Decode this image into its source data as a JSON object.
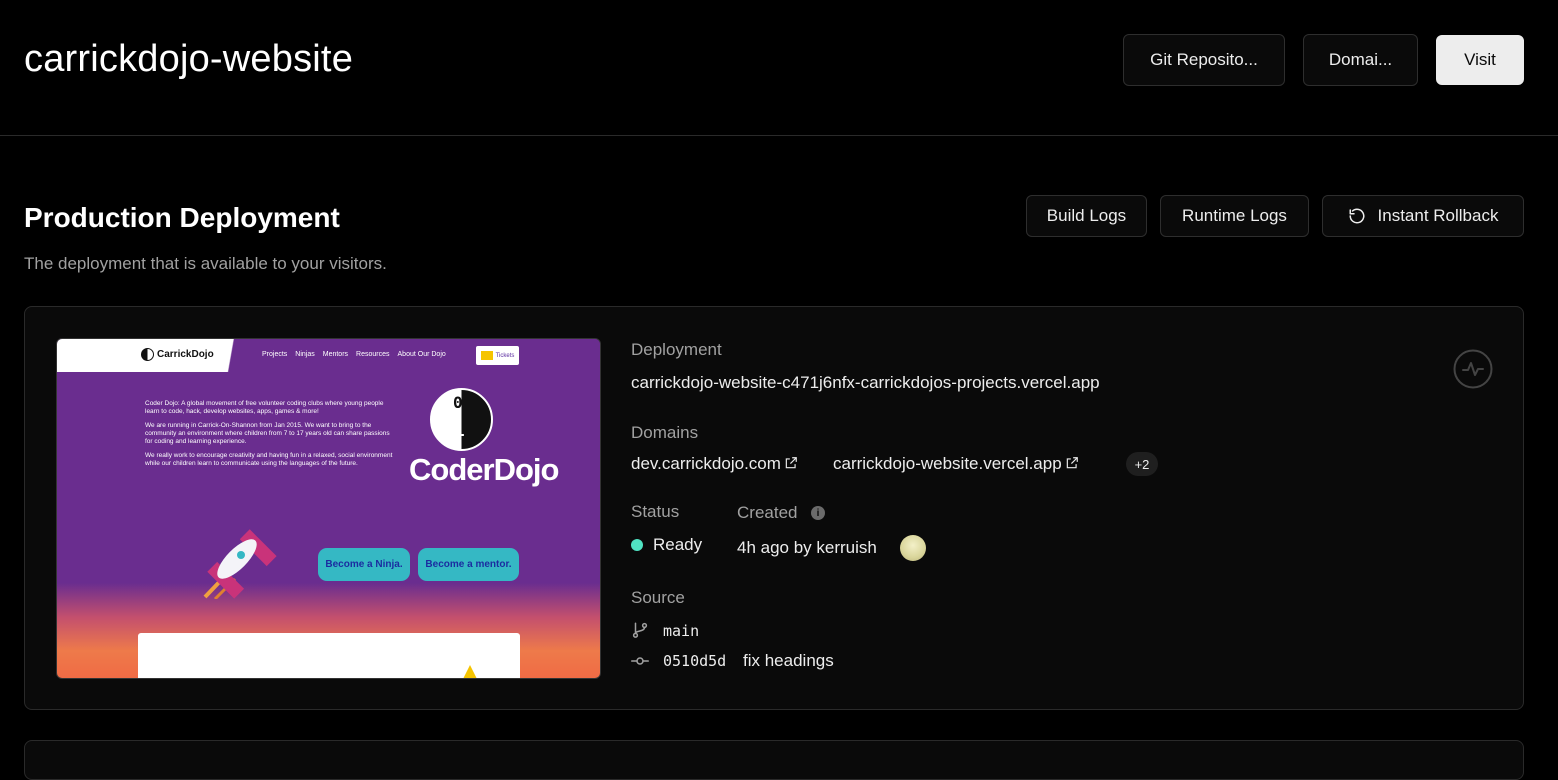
{
  "header": {
    "title": "carrickdojo-website",
    "git_repo_label": "Git Reposito...",
    "domains_label": "Domai...",
    "visit_label": "Visit"
  },
  "production": {
    "title": "Production Deployment",
    "subtitle": "The deployment that is available to your visitors.",
    "build_logs_label": "Build Logs",
    "runtime_logs_label": "Runtime Logs",
    "rollback_label": "Instant Rollback"
  },
  "preview": {
    "logo_text": "CarrickDojo",
    "nav_links": [
      "Projects",
      "Ninjas",
      "Mentors",
      "Resources",
      "About Our Dojo"
    ],
    "tickets_label": "Tickets",
    "paragraphs": [
      "Coder Dojo: A global movement of free volunteer coding clubs where young people learn to code, hack, develop websites, apps, games & more!",
      "We are running in Carrick-On-Shannon from Jan 2015. We want to bring to the community an environment where children from 7 to 17 years old can share passions for coding and learning experience.",
      "We really work to encourage creativity and having fun in a relaxed, social environment while our children learn to communicate using the languages of the future."
    ],
    "yin_top_digit": "0",
    "yin_bottom_digit": "1",
    "brand": "CoderDojo",
    "cta_ninja": "Become a Ninja.",
    "cta_mentor": "Become a mentor."
  },
  "deployment": {
    "deployment_label": "Deployment",
    "deployment_url": "carrickdojo-website-c471j6nfx-carrickdojos-projects.vercel.app",
    "domains_label": "Domains",
    "domain_1": "dev.carrickdojo.com",
    "domain_2": "carrickdojo-website.vercel.app",
    "domains_more": "+2",
    "status_label": "Status",
    "status_value": "Ready",
    "status_color": "#50e3c2",
    "created_label": "Created",
    "created_value": "4h ago by kerruish",
    "source_label": "Source",
    "branch": "main",
    "commit_hash": "0510d5d",
    "commit_message": "fix headings"
  }
}
